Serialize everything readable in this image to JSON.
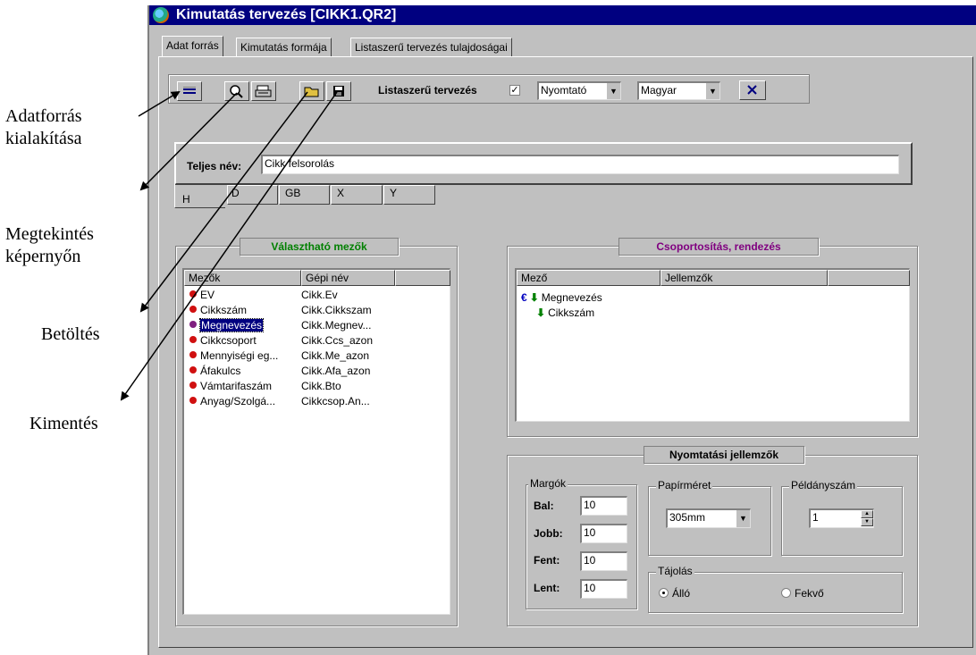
{
  "callouts": {
    "adatforras": "Adatforrás\nkialakítása",
    "megtekintes": "Megtekintés\nképernyőn",
    "betoltes": "Betöltés",
    "kimentes": "Kimentés"
  },
  "window": {
    "title": "Kimutatás tervezés [CIKK1.QR2]"
  },
  "tabs": [
    "Adat forrás",
    "Kimutatás formája",
    "Listaszerű tervezés tulajdoságai"
  ],
  "toolbar": {
    "listaszeru_label": "Listaszerű tervezés",
    "printer_value": "Nyomtató",
    "language_value": "Magyar"
  },
  "fullname": {
    "label": "Teljes név:",
    "value": "Cikk felsorolás"
  },
  "lang_tabs": [
    "H",
    "D",
    "GB",
    "X",
    "Y"
  ],
  "fields_group": {
    "title": "Választható mezők",
    "headers": [
      "Mezők",
      "Gépi név"
    ],
    "rows": [
      {
        "name": "EV",
        "machine": "Cikk.Ev"
      },
      {
        "name": "Cikkszám",
        "machine": "Cikk.Cikkszam"
      },
      {
        "name": "Megnevezés",
        "machine": "Cikk.Megnev..."
      },
      {
        "name": "Cikkcsoport",
        "machine": "Cikk.Ccs_azon"
      },
      {
        "name": "Mennyiségi eg...",
        "machine": "Cikk.Me_azon"
      },
      {
        "name": "Áfakulcs",
        "machine": "Cikk.Afa_azon"
      },
      {
        "name": "Vámtarifaszám",
        "machine": "Cikk.Bto"
      },
      {
        "name": "Anyag/Szolgá...",
        "machine": "Cikkcsop.An..."
      }
    ]
  },
  "group_sort": {
    "title": "Csoportosítás, rendezés",
    "headers": [
      "Mező",
      "Jellemzők"
    ],
    "rows": [
      "Megnevezés",
      "Cikkszám"
    ]
  },
  "print": {
    "title": "Nyomtatási jellemzők",
    "margins_title": "Margók",
    "margins": [
      {
        "label": "Bal:",
        "value": "10"
      },
      {
        "label": "Jobb:",
        "value": "10"
      },
      {
        "label": "Fent:",
        "value": "10"
      },
      {
        "label": "Lent:",
        "value": "10"
      }
    ],
    "paper_title": "Papírméret",
    "paper_value": "305mm",
    "copies_title": "Példányszám",
    "copies_value": "1",
    "orientation_title": "Tájolás",
    "portrait": "Álló",
    "landscape": "Fekvő"
  },
  "colors": {
    "title_bar": "#000080",
    "fields_title": "#008000",
    "group_title": "#800080"
  }
}
